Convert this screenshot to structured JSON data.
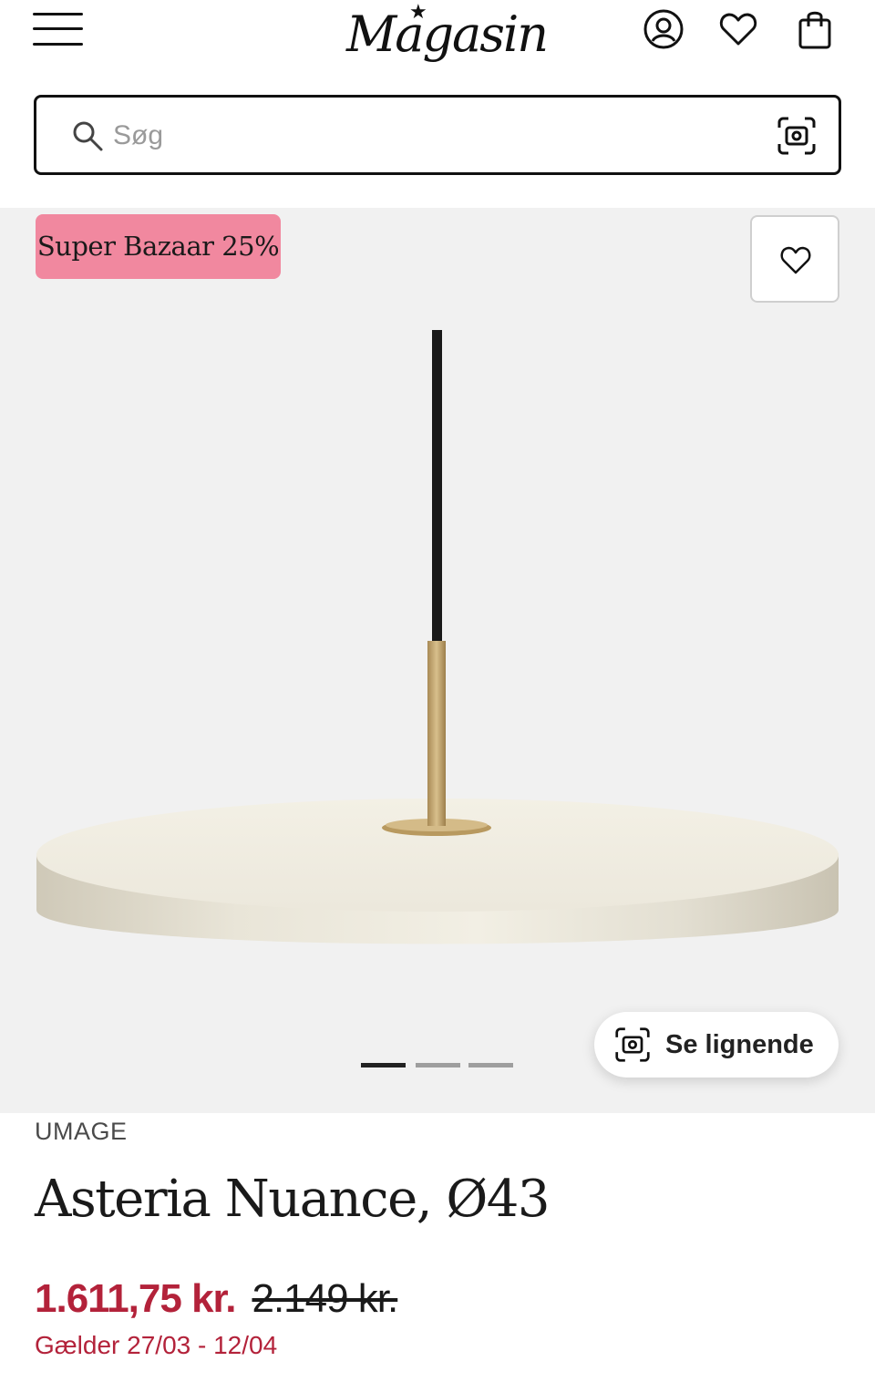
{
  "header": {
    "logo_text": "Magasin",
    "logo_star": "★",
    "menu_label": "Menu",
    "icons": [
      "account-icon",
      "heart-icon",
      "shopping-bag-icon"
    ]
  },
  "search": {
    "placeholder": "Søg",
    "value": "",
    "icons": [
      "search-icon",
      "visual-search-icon"
    ]
  },
  "product_gallery": {
    "badge": "Super Bazaar 25%",
    "badge_color": "#f1889f",
    "favorite_icon": "heart-icon",
    "image_subject": "pendant lamp",
    "slides_total": 3,
    "active_slide": 1,
    "similar_button_label": "Se lignende",
    "similar_button_icon": "visual-search-icon"
  },
  "product": {
    "brand": "UMAGE",
    "title": "Asteria Nuance, Ø43",
    "price_current": "1.611,75 kr.",
    "price_original": "2.149 kr.",
    "validity": "Gælder 27/03 - 12/04",
    "price_color": "#b3223a"
  }
}
